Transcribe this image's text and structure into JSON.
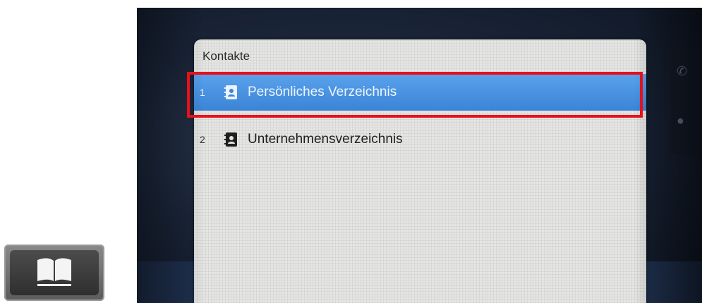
{
  "hardware_key": {
    "icon": "book-icon"
  },
  "dialog": {
    "title": "Kontakte",
    "items": [
      {
        "number": "1",
        "label": "Persönliches Verzeichnis",
        "icon": "address-book-icon",
        "selected": true
      },
      {
        "number": "2",
        "label": "Unternehmensverzeichnis",
        "icon": "address-book-icon",
        "selected": false
      }
    ]
  },
  "colors": {
    "selection": "#3b84d6",
    "highlight_border": "#e8101a",
    "dialog_bg": "#e5e6e4"
  }
}
